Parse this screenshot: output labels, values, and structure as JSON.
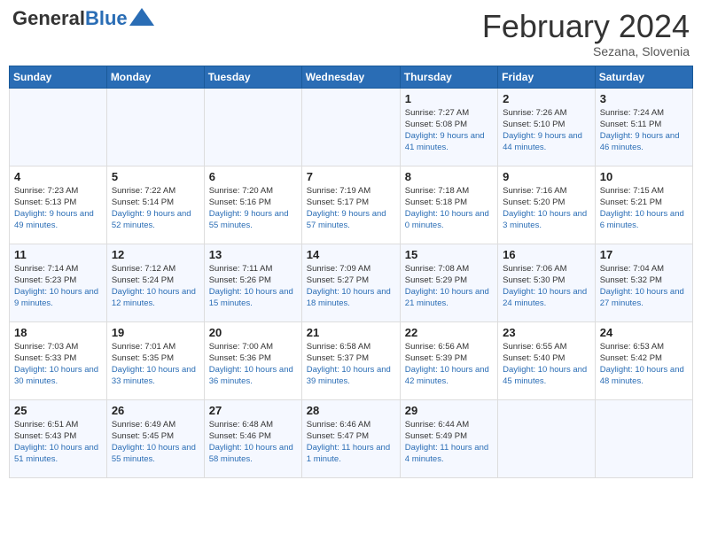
{
  "header": {
    "logo_general": "General",
    "logo_blue": "Blue",
    "month_title": "February 2024",
    "location": "Sezana, Slovenia"
  },
  "weekdays": [
    "Sunday",
    "Monday",
    "Tuesday",
    "Wednesday",
    "Thursday",
    "Friday",
    "Saturday"
  ],
  "weeks": [
    [
      {
        "day": "",
        "sunrise": "",
        "sunset": "",
        "daylight": ""
      },
      {
        "day": "",
        "sunrise": "",
        "sunset": "",
        "daylight": ""
      },
      {
        "day": "",
        "sunrise": "",
        "sunset": "",
        "daylight": ""
      },
      {
        "day": "",
        "sunrise": "",
        "sunset": "",
        "daylight": ""
      },
      {
        "day": "1",
        "sunrise": "Sunrise: 7:27 AM",
        "sunset": "Sunset: 5:08 PM",
        "daylight": "Daylight: 9 hours and 41 minutes."
      },
      {
        "day": "2",
        "sunrise": "Sunrise: 7:26 AM",
        "sunset": "Sunset: 5:10 PM",
        "daylight": "Daylight: 9 hours and 44 minutes."
      },
      {
        "day": "3",
        "sunrise": "Sunrise: 7:24 AM",
        "sunset": "Sunset: 5:11 PM",
        "daylight": "Daylight: 9 hours and 46 minutes."
      }
    ],
    [
      {
        "day": "4",
        "sunrise": "Sunrise: 7:23 AM",
        "sunset": "Sunset: 5:13 PM",
        "daylight": "Daylight: 9 hours and 49 minutes."
      },
      {
        "day": "5",
        "sunrise": "Sunrise: 7:22 AM",
        "sunset": "Sunset: 5:14 PM",
        "daylight": "Daylight: 9 hours and 52 minutes."
      },
      {
        "day": "6",
        "sunrise": "Sunrise: 7:20 AM",
        "sunset": "Sunset: 5:16 PM",
        "daylight": "Daylight: 9 hours and 55 minutes."
      },
      {
        "day": "7",
        "sunrise": "Sunrise: 7:19 AM",
        "sunset": "Sunset: 5:17 PM",
        "daylight": "Daylight: 9 hours and 57 minutes."
      },
      {
        "day": "8",
        "sunrise": "Sunrise: 7:18 AM",
        "sunset": "Sunset: 5:18 PM",
        "daylight": "Daylight: 10 hours and 0 minutes."
      },
      {
        "day": "9",
        "sunrise": "Sunrise: 7:16 AM",
        "sunset": "Sunset: 5:20 PM",
        "daylight": "Daylight: 10 hours and 3 minutes."
      },
      {
        "day": "10",
        "sunrise": "Sunrise: 7:15 AM",
        "sunset": "Sunset: 5:21 PM",
        "daylight": "Daylight: 10 hours and 6 minutes."
      }
    ],
    [
      {
        "day": "11",
        "sunrise": "Sunrise: 7:14 AM",
        "sunset": "Sunset: 5:23 PM",
        "daylight": "Daylight: 10 hours and 9 minutes."
      },
      {
        "day": "12",
        "sunrise": "Sunrise: 7:12 AM",
        "sunset": "Sunset: 5:24 PM",
        "daylight": "Daylight: 10 hours and 12 minutes."
      },
      {
        "day": "13",
        "sunrise": "Sunrise: 7:11 AM",
        "sunset": "Sunset: 5:26 PM",
        "daylight": "Daylight: 10 hours and 15 minutes."
      },
      {
        "day": "14",
        "sunrise": "Sunrise: 7:09 AM",
        "sunset": "Sunset: 5:27 PM",
        "daylight": "Daylight: 10 hours and 18 minutes."
      },
      {
        "day": "15",
        "sunrise": "Sunrise: 7:08 AM",
        "sunset": "Sunset: 5:29 PM",
        "daylight": "Daylight: 10 hours and 21 minutes."
      },
      {
        "day": "16",
        "sunrise": "Sunrise: 7:06 AM",
        "sunset": "Sunset: 5:30 PM",
        "daylight": "Daylight: 10 hours and 24 minutes."
      },
      {
        "day": "17",
        "sunrise": "Sunrise: 7:04 AM",
        "sunset": "Sunset: 5:32 PM",
        "daylight": "Daylight: 10 hours and 27 minutes."
      }
    ],
    [
      {
        "day": "18",
        "sunrise": "Sunrise: 7:03 AM",
        "sunset": "Sunset: 5:33 PM",
        "daylight": "Daylight: 10 hours and 30 minutes."
      },
      {
        "day": "19",
        "sunrise": "Sunrise: 7:01 AM",
        "sunset": "Sunset: 5:35 PM",
        "daylight": "Daylight: 10 hours and 33 minutes."
      },
      {
        "day": "20",
        "sunrise": "Sunrise: 7:00 AM",
        "sunset": "Sunset: 5:36 PM",
        "daylight": "Daylight: 10 hours and 36 minutes."
      },
      {
        "day": "21",
        "sunrise": "Sunrise: 6:58 AM",
        "sunset": "Sunset: 5:37 PM",
        "daylight": "Daylight: 10 hours and 39 minutes."
      },
      {
        "day": "22",
        "sunrise": "Sunrise: 6:56 AM",
        "sunset": "Sunset: 5:39 PM",
        "daylight": "Daylight: 10 hours and 42 minutes."
      },
      {
        "day": "23",
        "sunrise": "Sunrise: 6:55 AM",
        "sunset": "Sunset: 5:40 PM",
        "daylight": "Daylight: 10 hours and 45 minutes."
      },
      {
        "day": "24",
        "sunrise": "Sunrise: 6:53 AM",
        "sunset": "Sunset: 5:42 PM",
        "daylight": "Daylight: 10 hours and 48 minutes."
      }
    ],
    [
      {
        "day": "25",
        "sunrise": "Sunrise: 6:51 AM",
        "sunset": "Sunset: 5:43 PM",
        "daylight": "Daylight: 10 hours and 51 minutes."
      },
      {
        "day": "26",
        "sunrise": "Sunrise: 6:49 AM",
        "sunset": "Sunset: 5:45 PM",
        "daylight": "Daylight: 10 hours and 55 minutes."
      },
      {
        "day": "27",
        "sunrise": "Sunrise: 6:48 AM",
        "sunset": "Sunset: 5:46 PM",
        "daylight": "Daylight: 10 hours and 58 minutes."
      },
      {
        "day": "28",
        "sunrise": "Sunrise: 6:46 AM",
        "sunset": "Sunset: 5:47 PM",
        "daylight": "Daylight: 11 hours and 1 minute."
      },
      {
        "day": "29",
        "sunrise": "Sunrise: 6:44 AM",
        "sunset": "Sunset: 5:49 PM",
        "daylight": "Daylight: 11 hours and 4 minutes."
      },
      {
        "day": "",
        "sunrise": "",
        "sunset": "",
        "daylight": ""
      },
      {
        "day": "",
        "sunrise": "",
        "sunset": "",
        "daylight": ""
      }
    ]
  ]
}
